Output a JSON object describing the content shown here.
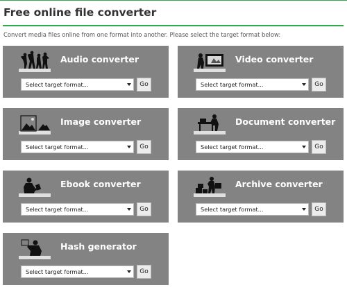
{
  "page": {
    "title": "Free online file converter",
    "subtitle": "Convert media files online from one format into another. Please select the target format below:"
  },
  "colors": {
    "accent": "#2fa84f",
    "card_bg": "#838383"
  },
  "converters": [
    {
      "name": "Audio converter",
      "icon": "audio-people-icon",
      "select_value": "Select target format...",
      "go_label": "Go"
    },
    {
      "name": "Video converter",
      "icon": "video-person-icon",
      "select_value": "Select target format...",
      "go_label": "Go"
    },
    {
      "name": "Image converter",
      "icon": "image-landscape-icon",
      "select_value": "Select target format...",
      "go_label": "Go"
    },
    {
      "name": "Document converter",
      "icon": "document-desk-icon",
      "select_value": "Select target format...",
      "go_label": "Go"
    },
    {
      "name": "Ebook converter",
      "icon": "ebook-reader-icon",
      "select_value": "Select target format...",
      "go_label": "Go"
    },
    {
      "name": "Archive converter",
      "icon": "archive-boxes-icon",
      "select_value": "Select target format...",
      "go_label": "Go"
    },
    {
      "name": "Hash generator",
      "icon": "hash-person-icon",
      "select_value": "Select target format...",
      "go_label": "Go"
    }
  ]
}
